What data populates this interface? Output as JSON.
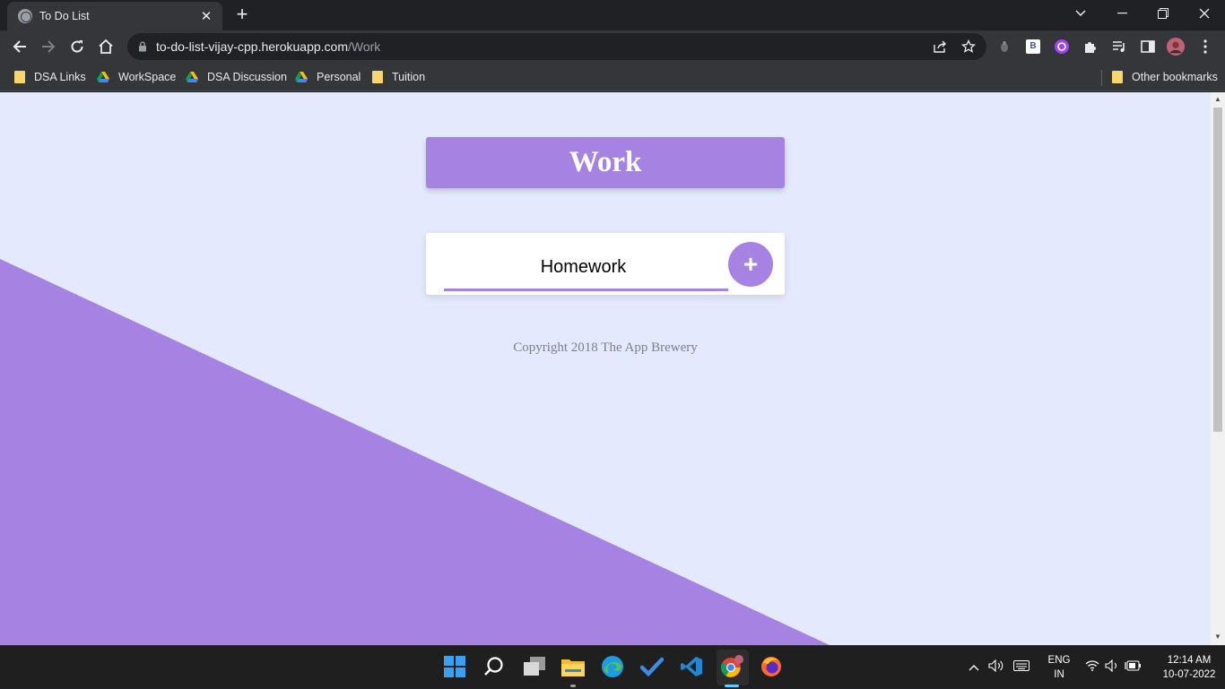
{
  "browser": {
    "tab_title": "To Do List",
    "url_host": "to-do-list-vijay-cpp.herokuapp.com",
    "url_path": "/Work",
    "extension_b_label": "B"
  },
  "bookmarks": [
    {
      "label": "DSA Links",
      "type": "folder"
    },
    {
      "label": "WorkSpace",
      "type": "drive"
    },
    {
      "label": "DSA Discussion",
      "type": "drive"
    },
    {
      "label": "Personal",
      "type": "drive"
    },
    {
      "label": "Tuition",
      "type": "folder"
    }
  ],
  "other_bookmarks": "Other bookmarks",
  "page": {
    "heading": "Work",
    "new_item_value": "Homework",
    "add_button_label": "+",
    "footer": "Copyright 2018 The App Brewery"
  },
  "colors": {
    "accent": "#a683e3",
    "page_background": "#e4e9fd"
  },
  "taskbar": {
    "language": "ENG",
    "region": "IN",
    "time": "12:14 AM",
    "date": "10-07-2022"
  }
}
